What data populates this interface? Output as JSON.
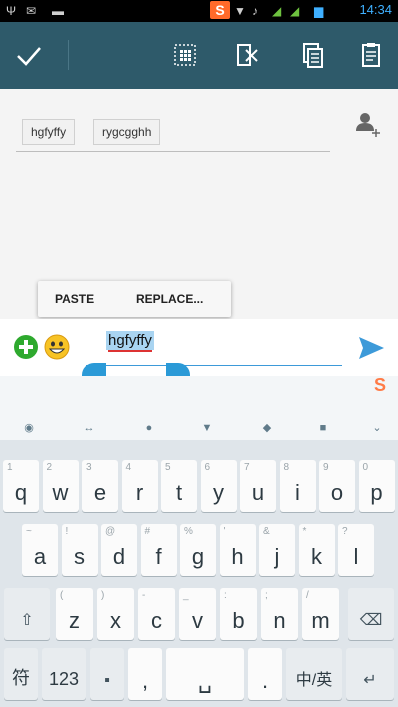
{
  "status_bar": {
    "time": "14:34",
    "icons": [
      "usb-icon",
      "message-icon",
      "sogou-icon",
      "wifi-icon",
      "signal-icon",
      "battery-icon"
    ]
  },
  "action_bar": {
    "buttons": [
      {
        "name": "done-button",
        "icon": "check-icon"
      },
      {
        "name": "select-all-button",
        "icon": "select-all-icon"
      },
      {
        "name": "cut-button",
        "icon": "cut-icon"
      },
      {
        "name": "copy-button",
        "icon": "copy-icon"
      },
      {
        "name": "paste-button",
        "icon": "clipboard-icon"
      }
    ]
  },
  "recipients": {
    "chips": [
      "hgfyffy",
      "rygcgghh"
    ]
  },
  "paste_popup": {
    "paste_label": "PASTE",
    "replace_label": "REPLACE..."
  },
  "compose": {
    "text": "hgfyffy"
  },
  "keyboard": {
    "row1": [
      {
        "main": "q",
        "sub": "1"
      },
      {
        "main": "w",
        "sub": "2"
      },
      {
        "main": "e",
        "sub": "3"
      },
      {
        "main": "r",
        "sub": "4"
      },
      {
        "main": "t",
        "sub": "5"
      },
      {
        "main": "y",
        "sub": "6"
      },
      {
        "main": "u",
        "sub": "7"
      },
      {
        "main": "i",
        "sub": "8"
      },
      {
        "main": "o",
        "sub": "9"
      },
      {
        "main": "p",
        "sub": "0"
      }
    ],
    "row2": [
      {
        "main": "a",
        "sub": "~"
      },
      {
        "main": "s",
        "sub": "!"
      },
      {
        "main": "d",
        "sub": "@"
      },
      {
        "main": "f",
        "sub": "#"
      },
      {
        "main": "g",
        "sub": "%"
      },
      {
        "main": "h",
        "sub": "'"
      },
      {
        "main": "j",
        "sub": "&"
      },
      {
        "main": "k",
        "sub": "*"
      },
      {
        "main": "l",
        "sub": "?"
      }
    ],
    "row3": [
      {
        "main": "z",
        "sub": "("
      },
      {
        "main": "x",
        "sub": ")"
      },
      {
        "main": "c",
        "sub": "-"
      },
      {
        "main": "v",
        "sub": "_"
      },
      {
        "main": "b",
        "sub": ":"
      },
      {
        "main": "n",
        "sub": ";"
      },
      {
        "main": "m",
        "sub": "/"
      }
    ],
    "row4": {
      "symbols": "符",
      "numbers": "123",
      "comma": ",",
      "period": ".",
      "lang": "中/英"
    }
  }
}
